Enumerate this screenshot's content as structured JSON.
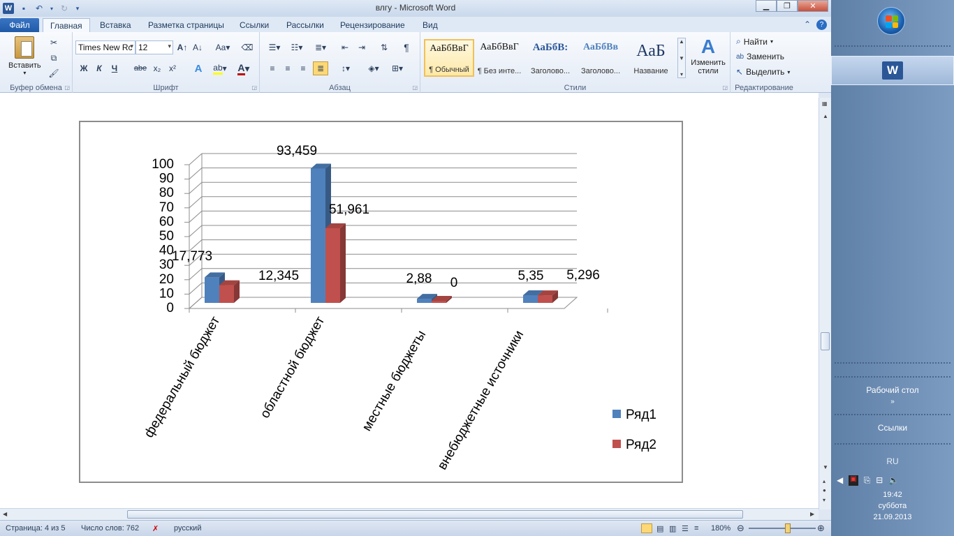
{
  "titlebar": {
    "title": "влгу  -  Microsoft Word"
  },
  "tabs": [
    "Файл",
    "Главная",
    "Вставка",
    "Разметка страницы",
    "Ссылки",
    "Рассылки",
    "Рецензирование",
    "Вид"
  ],
  "ribbon": {
    "clipboard": {
      "label": "Буфер обмена",
      "paste": "Вставить"
    },
    "font": {
      "label": "Шрифт",
      "family": "Times New Rc",
      "size": "12",
      "bold": "Ж",
      "italic": "К",
      "underline": "Ч",
      "strike": "abe",
      "sub": "x₂",
      "sup": "x²",
      "case": "Aa"
    },
    "paragraph": {
      "label": "Абзац",
      "pilcrow": "¶"
    },
    "styles": {
      "label": "Стили",
      "items": [
        {
          "preview": "АаБбВвГ",
          "name": "¶ Обычный"
        },
        {
          "preview": "АаБбВвГ",
          "name": "¶ Без инте..."
        },
        {
          "preview": "АаБбВ:",
          "name": "Заголово..."
        },
        {
          "preview": "АаБбВв",
          "name": "Заголово..."
        },
        {
          "preview": "АаБ",
          "name": "Название"
        }
      ],
      "change": "Изменить стили"
    },
    "editing": {
      "label": "Редактирование",
      "find": "Найти",
      "replace": "Заменить",
      "select": "Выделить"
    }
  },
  "chart_data": {
    "type": "bar",
    "categories": [
      "федеральный бюджет",
      "областной бюджет",
      "местные бюджеты",
      "внебюджетные источники"
    ],
    "series": [
      {
        "name": "Ряд1",
        "values": [
          17.773,
          93.459,
          2.88,
          5.35
        ],
        "labels": [
          "17,773",
          "93,459",
          "2,88",
          "5,35"
        ],
        "color": "#4f81bd"
      },
      {
        "name": "Ряд2",
        "values": [
          12.345,
          51.961,
          0,
          5.296
        ],
        "labels": [
          "12,345",
          "51,961",
          "0",
          "5,296"
        ],
        "color": "#c0504d"
      }
    ],
    "yticks": [
      "0",
      "10",
      "20",
      "30",
      "40",
      "50",
      "60",
      "70",
      "80",
      "90",
      "100"
    ],
    "ylim": [
      0,
      100
    ],
    "legend": "right",
    "grid": true,
    "style": "3d-clustered-column"
  },
  "statusbar": {
    "page": "Страница: 4 из 5",
    "words": "Число слов: 762",
    "lang": "русский",
    "zoom": "180%"
  },
  "taskbar": {
    "desktop": "Рабочий стол",
    "links": "Ссылки",
    "lang": "RU",
    "time": "19:42",
    "day": "суббота",
    "date": "21.09.2013"
  }
}
